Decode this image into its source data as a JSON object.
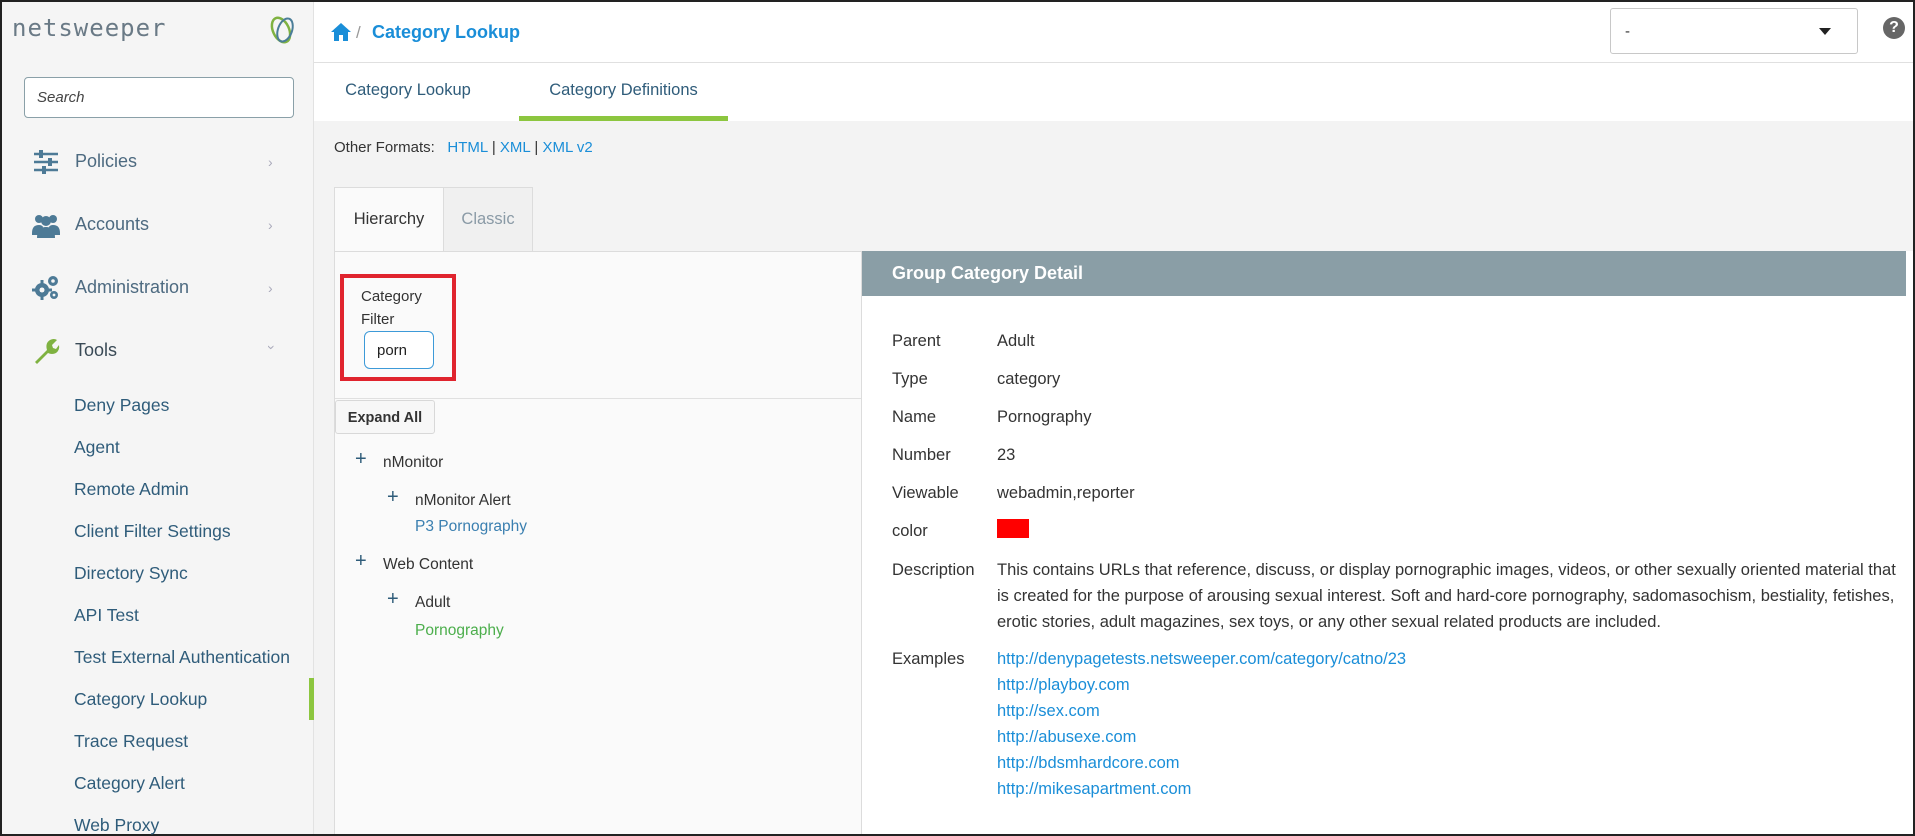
{
  "app": {
    "logo_text": "netsweeper"
  },
  "sidebar": {
    "search_placeholder": "Search",
    "nav": [
      {
        "label": "Policies",
        "icon": "sliders-icon"
      },
      {
        "label": "Accounts",
        "icon": "users-icon"
      },
      {
        "label": "Administration",
        "icon": "gears-icon"
      },
      {
        "label": "Tools",
        "icon": "wrench-icon"
      }
    ],
    "tools_items": [
      "Deny Pages",
      "Agent",
      "Remote Admin",
      "Client Filter Settings",
      "Directory Sync",
      "API Test",
      "Test External Authentication",
      "Category Lookup",
      "Trace Request",
      "Category Alert",
      "Web Proxy"
    ],
    "active_tool": "Category Lookup"
  },
  "topbar": {
    "breadcrumb_sep": "/",
    "title": "Category Lookup",
    "select_value": "-",
    "help": "?"
  },
  "tabs": [
    {
      "label": "Category Lookup",
      "active": false
    },
    {
      "label": "Category Definitions",
      "active": true
    }
  ],
  "formats": {
    "label": "Other Formats:",
    "links": [
      "HTML",
      "XML",
      "XML v2"
    ],
    "sep": "|"
  },
  "subtabs": [
    {
      "label": "Hierarchy",
      "active": true
    },
    {
      "label": "Classic",
      "active": false
    }
  ],
  "filter": {
    "label": "Category Filter",
    "value": "porn"
  },
  "expand_all": "Expand All",
  "tree": {
    "plus": "+",
    "nodes": [
      {
        "label": "nMonitor",
        "children": [
          {
            "label": "nMonitor Alert",
            "leaf": "P3 Pornography"
          }
        ]
      },
      {
        "label": "Web Content",
        "children": [
          {
            "label": "Adult",
            "leaf": "Pornography"
          }
        ]
      }
    ]
  },
  "detail": {
    "heading": "Group Category Detail",
    "labels": {
      "parent": "Parent",
      "type": "Type",
      "name": "Name",
      "number": "Number",
      "viewable": "Viewable",
      "color": "color",
      "description": "Description",
      "examples": "Examples"
    },
    "values": {
      "parent": "Adult",
      "type": "category",
      "name": "Pornography",
      "number": "23",
      "viewable": "webadmin,reporter",
      "color": "#ff0000",
      "description": "This contains URLs that reference, discuss, or display pornographic images, videos, or other sexually oriented material that is created for the purpose of arousing sexual interest. Soft and hard-core pornography, sadomasochism, bestiality, fetishes, erotic stories, adult magazines, sex toys, or any other sexual related products are included."
    },
    "examples": [
      "http://denypagetests.netsweeper.com/category/catno/23",
      "http://playboy.com",
      "http://sex.com",
      "http://abusexe.com",
      "http://bdsmhardcore.com",
      "http://mikesapartment.com"
    ]
  },
  "colors": {
    "accent": "#8cc63f",
    "link": "#1a8ed8",
    "nav_text": "#2f5c7a",
    "highlight": "#e0242e",
    "leaf_active": "#4cae4c"
  }
}
